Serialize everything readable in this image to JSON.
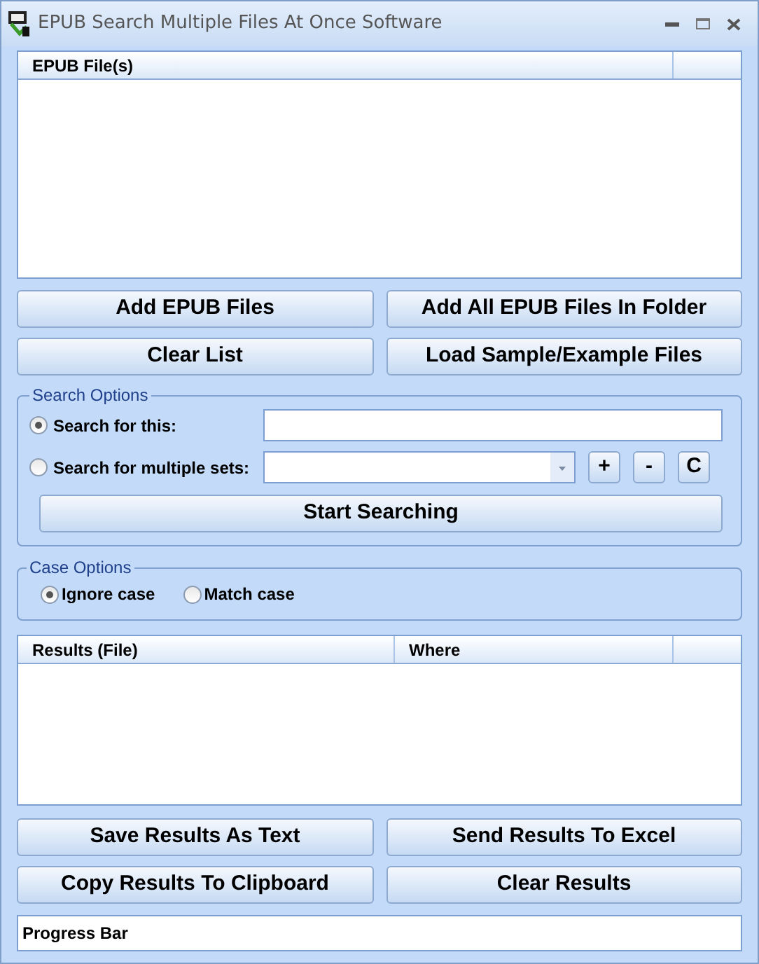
{
  "window": {
    "title": "EPUB Search Multiple Files At Once Software"
  },
  "file_list": {
    "columns": [
      "EPUB File(s)"
    ]
  },
  "file_buttons": [
    "Add EPUB Files",
    "Add All EPUB Files In Folder",
    "Clear List",
    "Load Sample/Example Files"
  ],
  "search_options": {
    "title": "Search Options",
    "modes": [
      {
        "label": "Search for this:",
        "selected": true,
        "kind": "text"
      },
      {
        "label": "Search for multiple sets:",
        "selected": false,
        "kind": "combo"
      }
    ],
    "set_buttons": [
      "+",
      "-",
      "C"
    ],
    "start_button": "Start Searching"
  },
  "case_options": {
    "title": "Case Options",
    "options": [
      {
        "label": "Ignore case",
        "selected": true
      },
      {
        "label": "Match case",
        "selected": false
      }
    ]
  },
  "results": {
    "columns": [
      "Results (File)",
      "Where"
    ]
  },
  "result_buttons": [
    "Save Results As Text",
    "Send Results To Excel",
    "Copy Results To Clipboard",
    "Clear Results"
  ],
  "progress": {
    "label": "Progress Bar"
  }
}
